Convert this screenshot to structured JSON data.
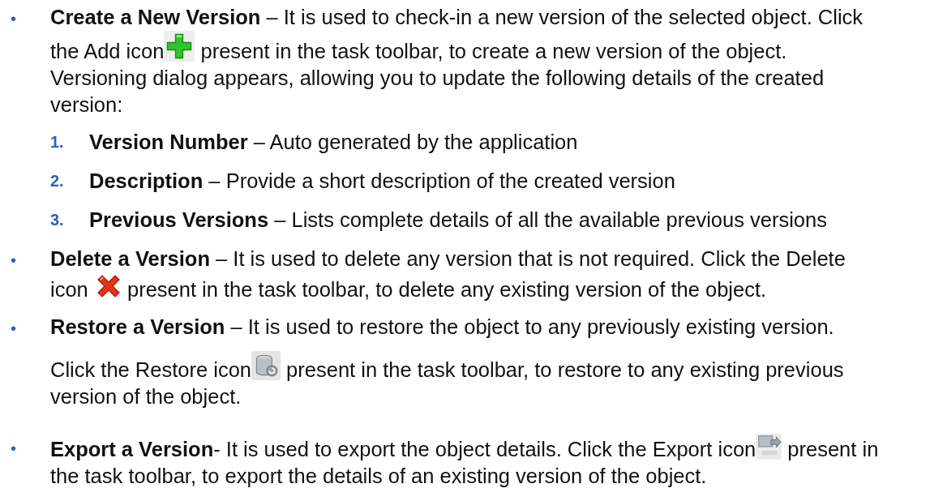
{
  "bullets": [
    {
      "marker": "•",
      "paragraphs": [
        [
          [
            {
              "kind": "text",
              "text": "**Create a New Version** – It is used to check-in a new version of the selected object. Click"
            }
          ],
          [
            {
              "kind": "text",
              "text": "the Add icon"
            },
            {
              "kind": "add_icon"
            },
            {
              "kind": "text",
              "text": " present in the task toolbar, to create a new version of the object."
            }
          ],
          [
            {
              "kind": "text",
              "text": "Versioning dialog appears, allowing you to update the following details of the created"
            }
          ],
          [
            {
              "kind": "text",
              "text": "version:"
            }
          ]
        ]
      ],
      "steps": [
        {
          "number": "1.",
          "text": "**Version Number** – Auto generated by the application"
        },
        {
          "number": "2.",
          "text": "**Description** – Provide a short description of the created version"
        },
        {
          "number": "3.",
          "text": "**Previous Versions** – Lists complete details of all the available previous versions"
        }
      ]
    },
    {
      "marker": "•",
      "paragraphs": [
        [
          [
            {
              "kind": "text",
              "text": "**Delete a Version** – It is used to delete any version that is not required. Click the Delete"
            }
          ],
          [
            {
              "kind": "text",
              "text": "icon "
            },
            {
              "kind": "delete_icon"
            },
            {
              "kind": "text",
              "text": " present in the task toolbar, to delete any existing version of the object."
            }
          ]
        ]
      ]
    },
    {
      "marker": "•",
      "paragraphs": [
        [
          [
            {
              "kind": "text",
              "text": "**Restore a Version** – It is used to restore the object to any previously existing version."
            }
          ]
        ],
        [
          [
            {
              "kind": "text",
              "text": "Click the Restore icon"
            },
            {
              "kind": "restore_icon"
            },
            {
              "kind": "text",
              "text": " present in the task toolbar, to restore to any existing previous"
            }
          ],
          [
            {
              "kind": "text",
              "text": "version of the object."
            }
          ]
        ]
      ]
    },
    {
      "marker": "•",
      "paragraphs": [
        [
          [
            {
              "kind": "text",
              "text": "**Export a Version**- It is used to export the object details. Click the Export icon"
            },
            {
              "kind": "export_icon"
            },
            {
              "kind": "text",
              "text": " present in"
            }
          ],
          [
            {
              "kind": "text",
              "text": "the task toolbar, to export the details of an existing version of the object."
            }
          ]
        ]
      ]
    }
  ]
}
